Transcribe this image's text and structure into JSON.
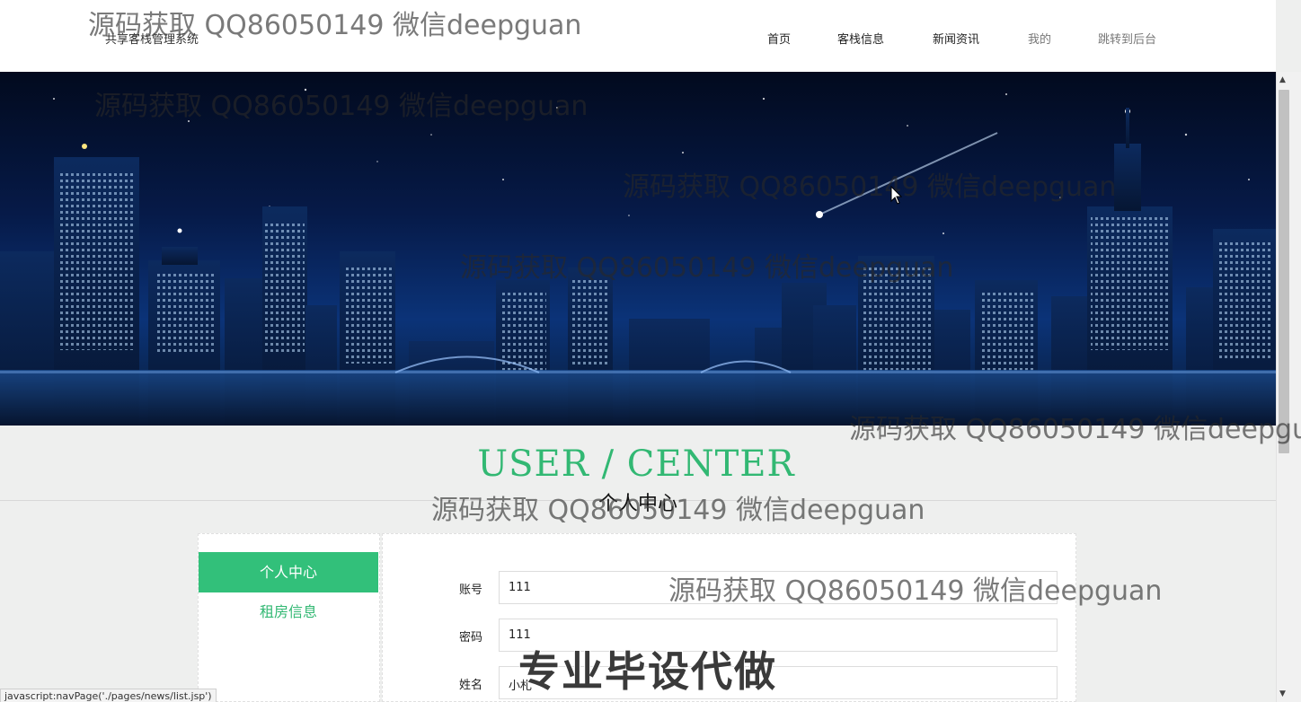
{
  "header": {
    "site_title": "共享客栈管理系统",
    "nav": [
      "首页",
      "客栈信息",
      "新闻资讯",
      "我的",
      "跳转到后台"
    ]
  },
  "section": {
    "title_en": "USER / CENTER",
    "title_cn": "个人中心"
  },
  "sidebar": {
    "items": [
      {
        "label": "个人中心",
        "active": true
      },
      {
        "label": "租房信息",
        "active": false
      }
    ]
  },
  "form": {
    "fields": [
      {
        "label": "账号",
        "value": "111"
      },
      {
        "label": "密码",
        "value": "111"
      },
      {
        "label": "姓名",
        "value": "小札"
      }
    ]
  },
  "status_bar": "javascript:navPage('./pages/news/list.jsp')",
  "watermark": {
    "text": "源码获取 QQ86050149 微信deepguan",
    "big_text": "专业毕设代做"
  },
  "colors": {
    "accent": "#32c07a",
    "accent_text": "#32b873"
  }
}
